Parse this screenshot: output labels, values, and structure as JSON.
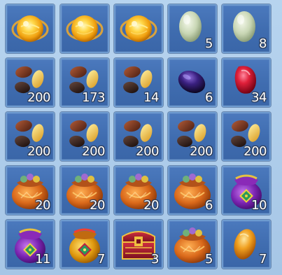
{
  "inventory": {
    "slots": [
      {
        "item": "golden-orb-icon",
        "qty": ""
      },
      {
        "item": "golden-orb-icon",
        "qty": ""
      },
      {
        "item": "golden-orb-icon",
        "qty": ""
      },
      {
        "item": "jade-stone-icon",
        "qty": "5"
      },
      {
        "item": "jade-stone-icon",
        "qty": "8"
      },
      {
        "item": "beans-icon",
        "qty": "200"
      },
      {
        "item": "beans-icon",
        "qty": "173"
      },
      {
        "item": "beans-icon",
        "qty": "14"
      },
      {
        "item": "dark-gem-icon",
        "qty": "6"
      },
      {
        "item": "ruby-gem-icon",
        "qty": "34"
      },
      {
        "item": "beans-icon",
        "qty": "200"
      },
      {
        "item": "beans-icon",
        "qty": "200"
      },
      {
        "item": "beans-icon",
        "qty": "200"
      },
      {
        "item": "beans-icon",
        "qty": "200"
      },
      {
        "item": "beans-icon",
        "qty": "200"
      },
      {
        "item": "orange-sack-icon",
        "qty": "20"
      },
      {
        "item": "orange-sack-icon",
        "qty": "20"
      },
      {
        "item": "orange-sack-icon",
        "qty": "20"
      },
      {
        "item": "orange-sack-icon",
        "qty": "6"
      },
      {
        "item": "purple-pouch-icon",
        "qty": "10"
      },
      {
        "item": "purple-pouch-icon",
        "qty": "11"
      },
      {
        "item": "gold-pouch-icon",
        "qty": "7"
      },
      {
        "item": "treasure-chest-icon",
        "qty": "3"
      },
      {
        "item": "orange-sack-icon",
        "qty": "5"
      },
      {
        "item": "amber-stone-icon",
        "qty": "7"
      }
    ]
  }
}
